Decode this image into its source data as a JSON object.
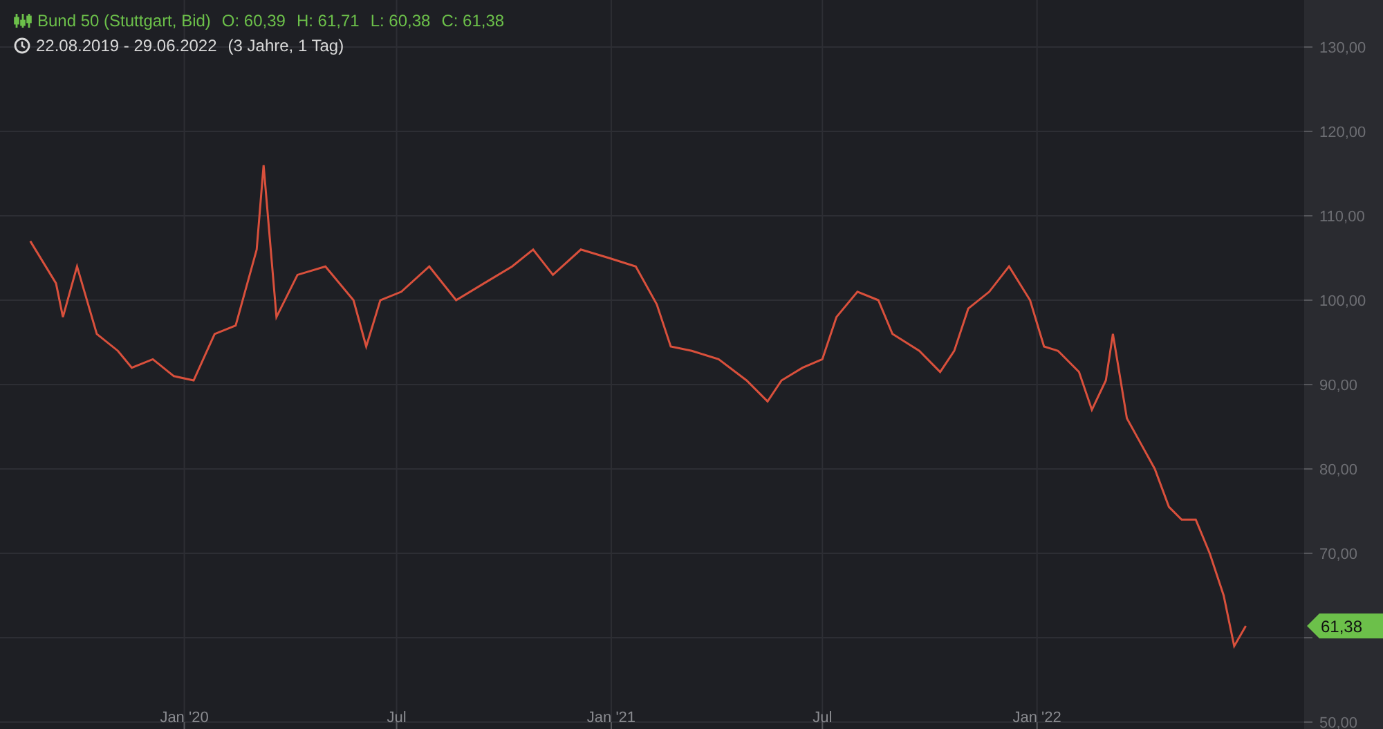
{
  "header": {
    "instrument": "Bund 50 (Stuttgart, Bid)",
    "ohlc": [
      {
        "label": "O:",
        "value": "60,39"
      },
      {
        "label": "H:",
        "value": "61,71"
      },
      {
        "label": "L:",
        "value": "60,38"
      },
      {
        "label": "C:",
        "value": "61,38"
      }
    ],
    "range": "22.08.2019 - 29.06.2022",
    "duration": "(3 Jahre, 1 Tag)"
  },
  "price_tag": {
    "value": "61,38",
    "color": "#6cc04a"
  },
  "chart": {
    "chart_data": {
      "type": "line",
      "grid": true,
      "xlim": [
        "2019-07-27",
        "2022-08-18"
      ],
      "ylim": [
        50,
        130
      ],
      "xticks": [
        {
          "value": "2020-01-01",
          "label": "Jan '20"
        },
        {
          "value": "2020-07-01",
          "label": "Jul"
        },
        {
          "value": "2021-01-01",
          "label": "Jan '21"
        },
        {
          "value": "2021-07-01",
          "label": "Jul"
        },
        {
          "value": "2022-01-01",
          "label": "Jan '22"
        }
      ],
      "yticks": [
        {
          "value": 50,
          "label": "50,00"
        },
        {
          "value": 70,
          "label": "70,00"
        },
        {
          "value": 80,
          "label": "80,00"
        },
        {
          "value": 90,
          "label": "90,00"
        },
        {
          "value": 100,
          "label": "100,00"
        },
        {
          "value": 110,
          "label": "110,00"
        },
        {
          "value": 120,
          "label": "120,00"
        },
        {
          "value": 130,
          "label": "130,00"
        }
      ],
      "x": [
        "2019-08-22",
        "2019-09-13",
        "2019-09-19",
        "2019-10-01",
        "2019-10-18",
        "2019-11-05",
        "2019-11-17",
        "2019-12-05",
        "2019-12-23",
        "2020-01-09",
        "2020-01-27",
        "2020-02-14",
        "2020-03-03",
        "2020-03-09",
        "2020-03-20",
        "2020-04-07",
        "2020-05-01",
        "2020-05-25",
        "2020-06-05",
        "2020-06-17",
        "2020-07-05",
        "2020-07-29",
        "2020-08-21",
        "2020-09-14",
        "2020-10-08",
        "2020-10-26",
        "2020-11-12",
        "2020-12-06",
        "2020-12-30",
        "2021-01-22",
        "2021-02-09",
        "2021-02-21",
        "2021-03-11",
        "2021-04-03",
        "2021-04-27",
        "2021-05-15",
        "2021-05-27",
        "2021-06-14",
        "2021-07-01",
        "2021-07-13",
        "2021-07-31",
        "2021-08-18",
        "2021-08-30",
        "2021-09-22",
        "2021-10-10",
        "2021-10-22",
        "2021-11-03",
        "2021-11-21",
        "2021-12-08",
        "2021-12-26",
        "2022-01-07",
        "2022-01-19",
        "2022-02-06",
        "2022-02-17",
        "2022-03-01",
        "2022-03-07",
        "2022-03-19",
        "2022-03-31",
        "2022-04-12",
        "2022-04-24",
        "2022-05-05",
        "2022-05-17",
        "2022-05-29",
        "2022-06-10",
        "2022-06-19",
        "2022-06-29"
      ],
      "series": [
        {
          "color": "#d9503c",
          "values": [
            107,
            102,
            98,
            104,
            96,
            94,
            92,
            93,
            91,
            90.5,
            96,
            97,
            106,
            116,
            98,
            103,
            104,
            100,
            94.5,
            100,
            101,
            104,
            100,
            102,
            104,
            106,
            103,
            106,
            105,
            104,
            99.5,
            94.5,
            94,
            93,
            90.5,
            88,
            90.5,
            92,
            93,
            98,
            101,
            100,
            96,
            94,
            91.5,
            94,
            99,
            101,
            104,
            100,
            94.5,
            94,
            91.5,
            87,
            90.5,
            96,
            86,
            83,
            80,
            75.5,
            74,
            74,
            70,
            65,
            59,
            61.4
          ]
        }
      ]
    }
  }
}
